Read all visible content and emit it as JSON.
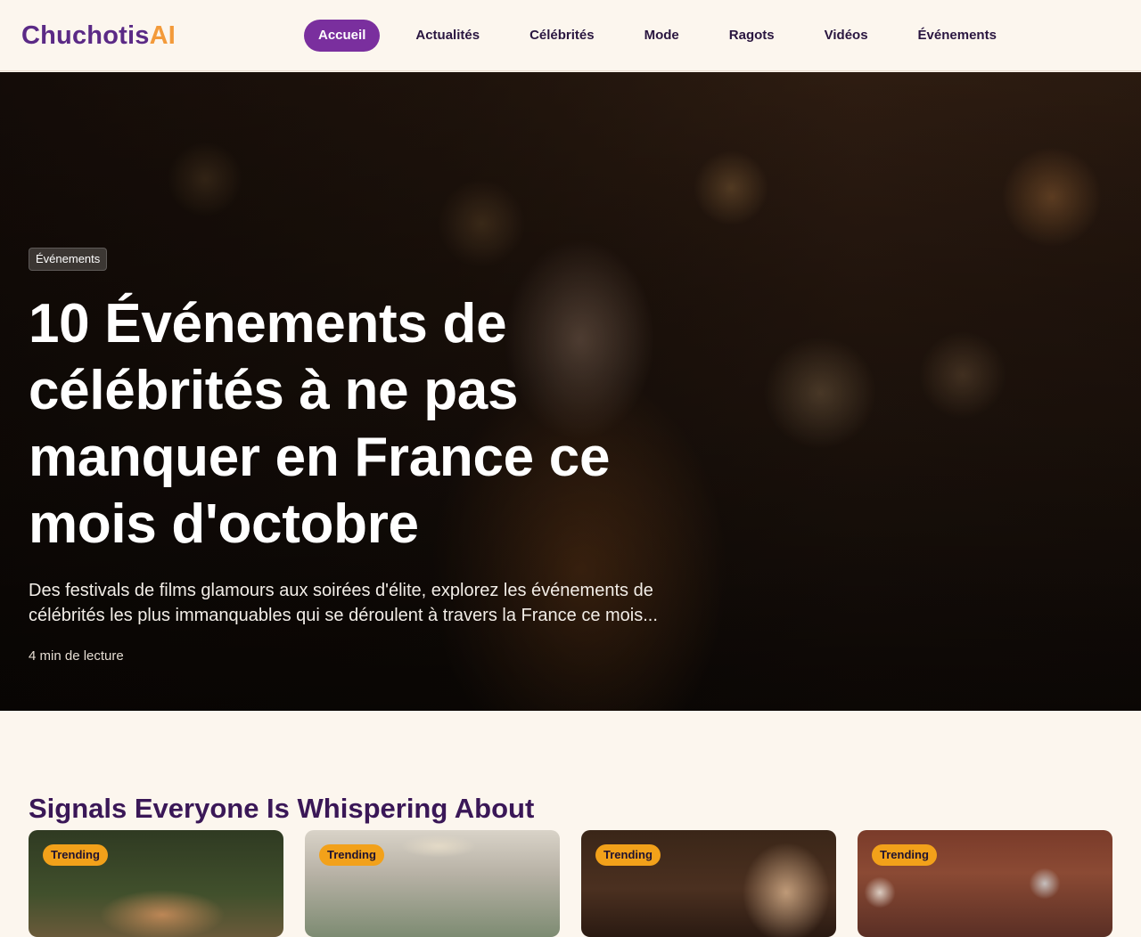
{
  "brand": {
    "part1": "Chuchotis",
    "part2": "AI"
  },
  "nav": {
    "items": [
      {
        "label": "Accueil"
      },
      {
        "label": "Actualités"
      },
      {
        "label": "Célébrités"
      },
      {
        "label": "Mode"
      },
      {
        "label": "Ragots"
      },
      {
        "label": "Vidéos"
      },
      {
        "label": "Événements"
      }
    ],
    "active_index": 0
  },
  "hero": {
    "category": "Événements",
    "title": "10 Événements de célébrités à ne pas manquer en France ce mois d'octobre",
    "description": "Des festivals de films glamours aux soirées d'élite, explorez les événements de célébrités les plus immanquables qui se déroulent à travers la France ce mois...",
    "read_time": "4 min de lecture"
  },
  "section": {
    "title": "Signals Everyone Is Whispering About"
  },
  "cards": [
    {
      "badge": "Trending"
    },
    {
      "badge": "Trending"
    },
    {
      "badge": "Trending"
    },
    {
      "badge": "Trending"
    }
  ],
  "colors": {
    "background": "#fcf6ee",
    "brand_primary": "#5b2a86",
    "brand_accent": "#f39a3a",
    "nav_active": "#7a2f9e",
    "section_title": "#3a1757",
    "badge": "#f2a11a"
  }
}
